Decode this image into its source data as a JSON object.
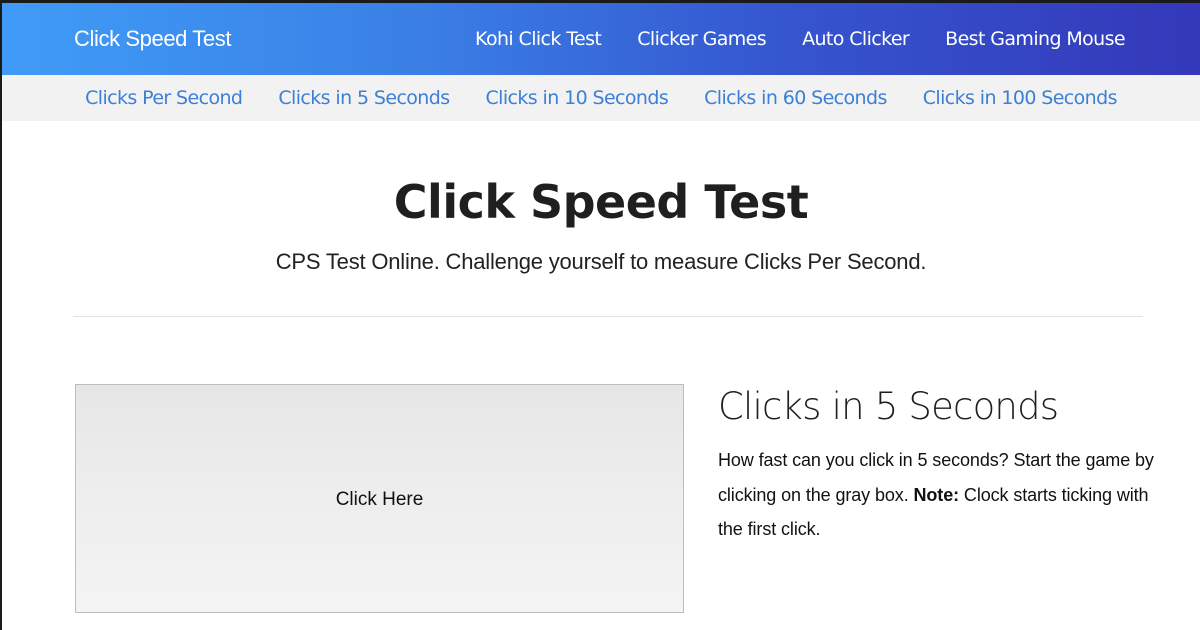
{
  "header": {
    "brand": "Click Speed Test",
    "nav": [
      {
        "label": "Kohi Click Test"
      },
      {
        "label": "Clicker Games"
      },
      {
        "label": "Auto Clicker"
      },
      {
        "label": "Best Gaming Mouse"
      }
    ],
    "gradient_colors": [
      "#3f9cf6",
      "#3438b9"
    ]
  },
  "subnav": {
    "items": [
      {
        "label": "Clicks Per Second"
      },
      {
        "label": "Clicks in 5 Seconds"
      },
      {
        "label": "Clicks in 10 Seconds"
      },
      {
        "label": "Clicks in 60 Seconds"
      },
      {
        "label": "Clicks in 100 Seconds"
      }
    ],
    "link_color": "#3b7fd6"
  },
  "hero": {
    "title": "Click Speed Test",
    "subtitle": "CPS Test Online. Challenge yourself to measure Clicks Per Second."
  },
  "game": {
    "click_area_label": "Click Here"
  },
  "info": {
    "heading": "Clicks in 5 Seconds",
    "text_before": "How fast can you click in 5 seconds? Start the game by clicking on the gray box. ",
    "note_label": "Note:",
    "text_after": " Clock starts ticking with the first click."
  }
}
